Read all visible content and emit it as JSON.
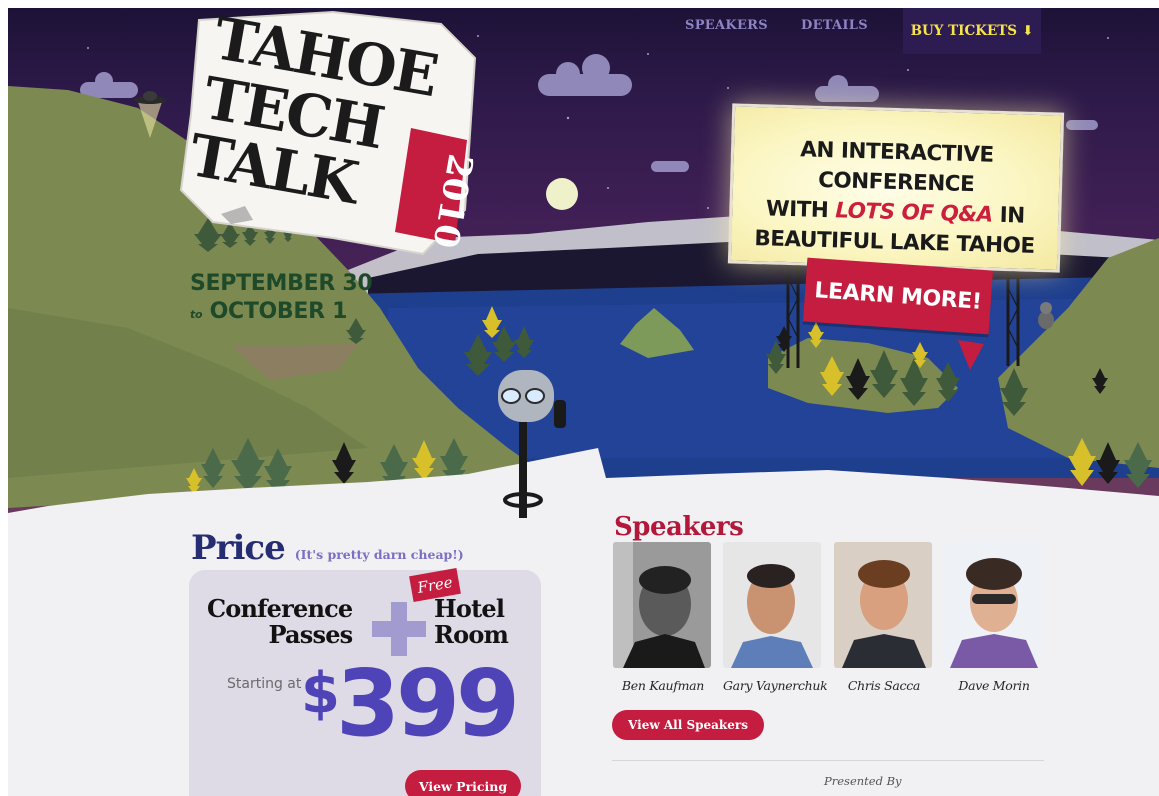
{
  "nav": {
    "speakers_label": "SPEAKERS",
    "details_label": "DETAILS",
    "buy_label": "BUY TICKETS"
  },
  "logo": {
    "line1": "TAHOE",
    "line2": "TECH",
    "line3": "TALK",
    "year": "2010"
  },
  "dates": {
    "start": "SEPTEMBER 30",
    "to": "to",
    "end": "OCTOBER 1"
  },
  "billboard": {
    "line1": "AN INTERACTIVE CONFERENCE",
    "line2_a": "WITH ",
    "line2_highlight": "LOTS OF Q&A",
    "line2_b": " IN",
    "line3": "BEAUTIFUL LAKE TAHOE",
    "cta_label": "LEARN MORE!"
  },
  "price": {
    "title": "Price",
    "subtitle": "(It's pretty darn cheap!)",
    "item1_line1": "Conference",
    "item1_line2": "Passes",
    "free_tag": "Free",
    "item2_line1": "Hotel",
    "item2_line2": "Room",
    "starting_label": "Starting at",
    "currency": "$",
    "amount": "399",
    "button_label": "View Pricing"
  },
  "speakers": {
    "title": "Speakers",
    "items": [
      {
        "name": "Ben Kaufman"
      },
      {
        "name": "Gary Vaynerchuk"
      },
      {
        "name": "Chris Sacca"
      },
      {
        "name": "Dave Morin"
      }
    ],
    "view_all_label": "View All Speakers",
    "presented_by": "Presented By"
  },
  "colors": {
    "brand_red": "#c41d40",
    "price_purple": "#4e44b8",
    "navy": "#262d73",
    "nav_yellow": "#f7e34c"
  }
}
